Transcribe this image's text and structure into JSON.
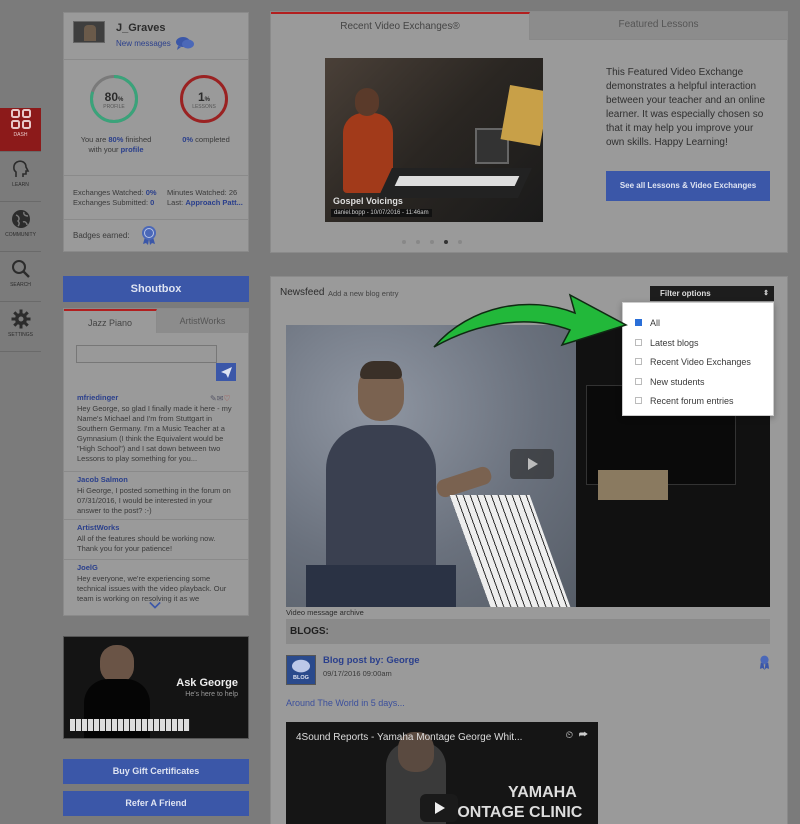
{
  "nav": [
    {
      "label": "DASH",
      "icon": "dashboard-icon"
    },
    {
      "label": "LEARN",
      "icon": "learn-icon"
    },
    {
      "label": "COMMUNITY",
      "icon": "globe-icon"
    },
    {
      "label": "SEARCH",
      "icon": "search-icon"
    },
    {
      "label": "SETTINGS",
      "icon": "gear-icon"
    }
  ],
  "profile": {
    "username": "J_Graves",
    "new_messages": "New messages",
    "profile_pct": "80",
    "profile_unit": "%",
    "profile_label": "PROFILE",
    "profile_fraction": 0.8,
    "lessons_count": "1",
    "lessons_unit": "%",
    "lessons_label": "LESSONS",
    "lessons_fraction": 0.01,
    "finished_prefix": "You are ",
    "finished_pct": "80%",
    "finished_mid": " finished",
    "finished_line2": "with your ",
    "finished_link": "profile",
    "completed_pct": "0%",
    "completed_text": " completed",
    "exchanges_watched_label": "Exchanges Watched: ",
    "exchanges_watched_value": "0%",
    "exchanges_submitted_label": "Exchanges Submitted: ",
    "exchanges_submitted_value": "0",
    "minutes_watched_label": "Minutes Watched: ",
    "minutes_watched_value": "26",
    "last_label": "Last: ",
    "last_value": "Approach Patt...",
    "badges_label": "Badges earned:"
  },
  "featured": {
    "tabs": [
      "Recent Video Exchanges®",
      "Featured Lessons"
    ],
    "video_title": "Gospel Voicings",
    "video_meta": "daniel.bopp - 10/07/2016 - 11:46am",
    "description": "This Featured Video Exchange demonstrates a helpful interaction between your teacher and an online learner. It was especially chosen so that it may help you improve your own skills. Happy Learning!",
    "see_all_button": "See all Lessons & Video Exchanges"
  },
  "shoutbox": {
    "title": "Shoutbox",
    "tabs": [
      "Jazz Piano",
      "ArtistWorks"
    ],
    "messages": [
      {
        "user": "mfriedinger",
        "text": "Hey George, so glad I finally made it here - my Name's Michael and I'm from Stuttgart in Southern Germany. I'm a Music Teacher at a Gymnasium (I think the Equivalent would be \"High School\") and I sat down between two Lessons to play something for you..."
      },
      {
        "user": "Jacob Salmon",
        "text": "Hi George, I posted something in the forum on 07/31/2016, I would be interested in your answer to the post? :-)"
      },
      {
        "user": "ArtistWorks",
        "text": "All of the features should be working now. Thank you for your patience!"
      },
      {
        "user": "JoelG",
        "text": "Hey everyone, we're experiencing some technical issues with the video playback. Our team is working on resolving it as we"
      }
    ]
  },
  "ask": {
    "title": "Ask George",
    "subtitle": "He's here to help"
  },
  "buttons": {
    "gift": "Buy Gift Certificates",
    "refer": "Refer A Friend"
  },
  "newsfeed": {
    "title": "Newsfeed",
    "add_blog": "Add a new blog entry",
    "filter_label": "Filter options",
    "filter_options": [
      {
        "label": "All",
        "checked": true
      },
      {
        "label": "Latest blogs",
        "checked": false
      },
      {
        "label": "Recent Video Exchanges",
        "checked": false
      },
      {
        "label": "New students",
        "checked": false
      },
      {
        "label": "Recent forum entries",
        "checked": false
      }
    ],
    "video_archive": "Video message archive",
    "blogs_header": "BLOGS:",
    "blog_icon_text": "BLOG",
    "blog_title": "Blog post by: George",
    "blog_date": "09/17/2016 09:00am",
    "blog_link": "Around The World in 5 days...",
    "embed_title": "4Sound Reports - Yamaha Montage George Whit...",
    "embed_overlay_1": "YAMAHA",
    "embed_overlay_2": "MONTAGE CLINIC"
  },
  "colors": {
    "accent": "#3b57a8",
    "nav_active": "#8c1a1a",
    "arrow": "#22b83a",
    "tab_active": "#b21f1f"
  }
}
